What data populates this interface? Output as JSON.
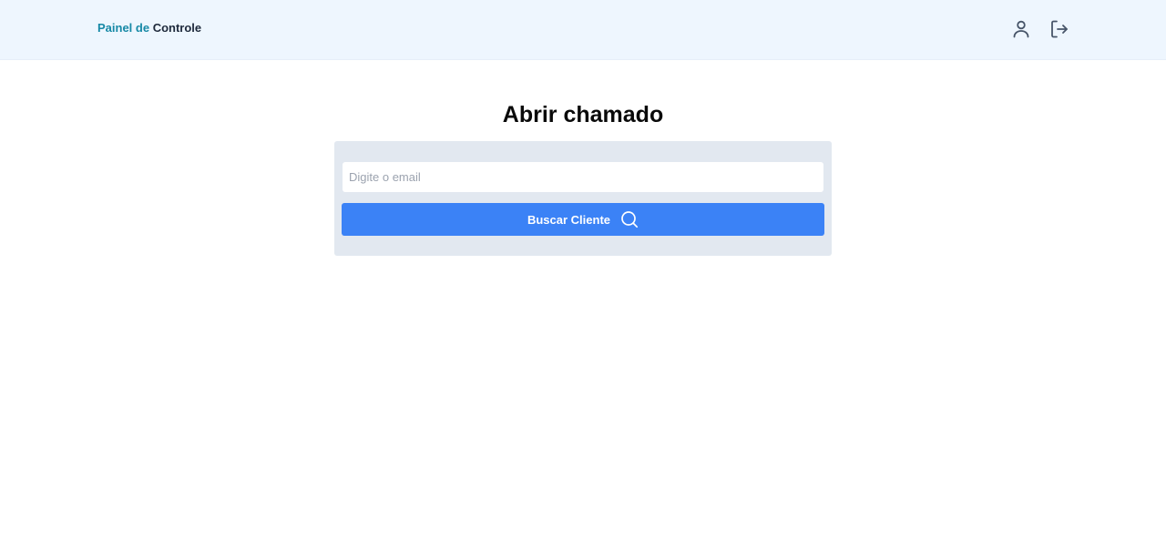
{
  "header": {
    "brand_part1": "Painel de",
    "brand_part2": "Controle",
    "icons": [
      "user-icon",
      "logout-icon"
    ]
  },
  "main": {
    "title": "Abrir chamado",
    "email_placeholder": "Digite o email",
    "email_value": "",
    "search_button_label": "Buscar Cliente",
    "search_button_icon": "search-icon"
  },
  "colors": {
    "header_bg": "#eef6fe",
    "brand_accent": "#1789a6",
    "card_bg": "#e2e8f0",
    "button_bg": "#3b82f6"
  }
}
